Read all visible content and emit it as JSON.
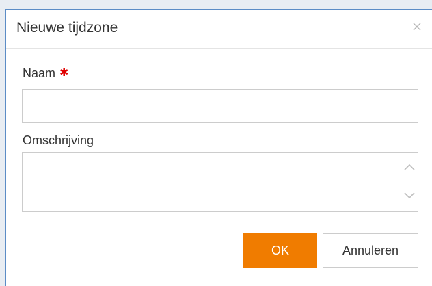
{
  "dialog": {
    "title": "Nieuwe tijdzone",
    "close_icon": "close-icon"
  },
  "form": {
    "name": {
      "label": "Naam",
      "required_marker": "✱",
      "value": ""
    },
    "description": {
      "label": "Omschrijving",
      "value": ""
    }
  },
  "buttons": {
    "ok_label": "OK",
    "cancel_label": "Annuleren"
  },
  "colors": {
    "accent": "#f07c00",
    "required": "#e00000",
    "dialog_border": "#5b8cc6",
    "background": "#e8edf3"
  }
}
